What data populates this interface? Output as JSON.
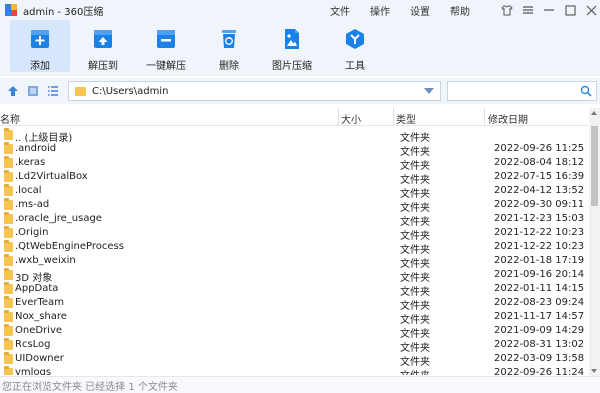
{
  "window": {
    "title": "admin - 360压缩"
  },
  "menu": [
    {
      "label": "文件"
    },
    {
      "label": "操作"
    },
    {
      "label": "设置"
    },
    {
      "label": "帮助"
    }
  ],
  "toolbar": [
    {
      "label": "添加",
      "icon": "add-icon",
      "active": true
    },
    {
      "label": "解压到",
      "icon": "extract-to-icon",
      "active": false
    },
    {
      "label": "一键解压",
      "icon": "one-click-extract-icon",
      "active": false
    },
    {
      "label": "删除",
      "icon": "delete-icon",
      "active": false
    },
    {
      "label": "图片压缩",
      "icon": "image-compress-icon",
      "active": false
    },
    {
      "label": "工具",
      "icon": "tools-icon",
      "active": false
    }
  ],
  "address": {
    "path": "C:\\Users\\admin"
  },
  "columns": {
    "name": "名称",
    "size": "大小",
    "type": "类型",
    "modified": "修改日期"
  },
  "files": [
    {
      "name": ".. (上级目录)",
      "type": "文件夹",
      "modified": ""
    },
    {
      "name": ".android",
      "type": "文件夹",
      "modified": "2022-09-26 11:25"
    },
    {
      "name": ".keras",
      "type": "文件夹",
      "modified": "2022-08-04 18:12"
    },
    {
      "name": ".Ld2VirtualBox",
      "type": "文件夹",
      "modified": "2022-07-15 16:39"
    },
    {
      "name": ".local",
      "type": "文件夹",
      "modified": "2022-04-12 13:52"
    },
    {
      "name": ".ms-ad",
      "type": "文件夹",
      "modified": "2022-09-30 09:11"
    },
    {
      "name": ".oracle_jre_usage",
      "type": "文件夹",
      "modified": "2021-12-23 15:03"
    },
    {
      "name": ".Origin",
      "type": "文件夹",
      "modified": "2021-12-22 10:23"
    },
    {
      "name": ".QtWebEngineProcess",
      "type": "文件夹",
      "modified": "2021-12-22 10:23"
    },
    {
      "name": ".wxb_weixin",
      "type": "文件夹",
      "modified": "2022-01-18 17:19"
    },
    {
      "name": "3D 对象",
      "type": "文件夹",
      "modified": "2021-09-16 20:14"
    },
    {
      "name": "AppData",
      "type": "文件夹",
      "modified": "2022-01-11 14:15"
    },
    {
      "name": "EverTeam",
      "type": "文件夹",
      "modified": "2022-08-23 09:24"
    },
    {
      "name": "Nox_share",
      "type": "文件夹",
      "modified": "2021-11-17 14:57"
    },
    {
      "name": "OneDrive",
      "type": "文件夹",
      "modified": "2021-09-09 14:29"
    },
    {
      "name": "RcsLog",
      "type": "文件夹",
      "modified": "2022-08-31 13:02"
    },
    {
      "name": "UIDowner",
      "type": "文件夹",
      "modified": "2022-03-09 13:58"
    },
    {
      "name": "vmlogs",
      "type": "文件夹",
      "modified": "2022-09-26 11:24"
    }
  ],
  "status": {
    "text": "您正在浏览文件夹 已经选择 1 个文件夹"
  },
  "colors": {
    "chrome": "#f0f5fc",
    "accent": "#1a82e6",
    "folder": "#f5c451"
  }
}
